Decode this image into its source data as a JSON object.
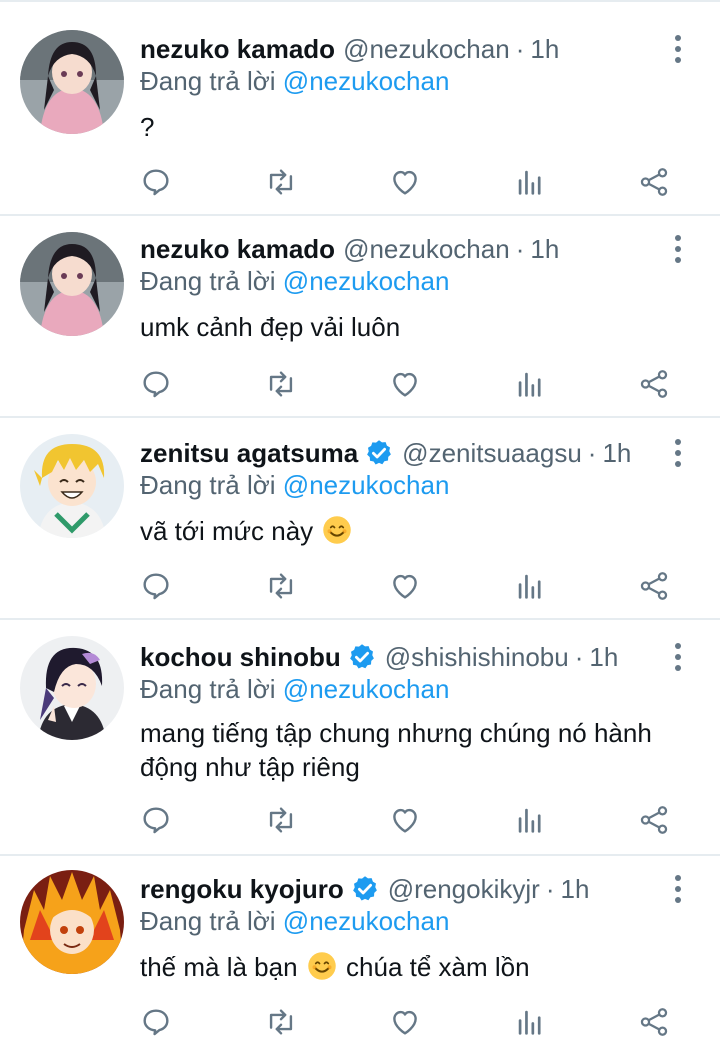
{
  "reply_prefix": "Đang trả lời",
  "tweets": [
    {
      "name": "nezuko kamado",
      "handle": "@nezukochan",
      "dot": "·",
      "time": "1h",
      "verified": false,
      "mention": "@nezukochan",
      "text": "?",
      "avatar_icon": "nezuko-avatar"
    },
    {
      "name": "nezuko kamado",
      "handle": "@nezukochan",
      "dot": "·",
      "time": "1h",
      "verified": false,
      "mention": "@nezukochan",
      "text": "umk cảnh đẹp vải luôn",
      "avatar_icon": "nezuko-avatar"
    },
    {
      "name": "zenitsu agatsuma",
      "handle": "@zenitsuaagsu",
      "dot": "·",
      "time": "1h",
      "verified": true,
      "mention": "@nezukochan",
      "text": "vã tới mức này",
      "text_after_emoji": "",
      "avatar_icon": "zenitsu-avatar"
    },
    {
      "name": "kochou shinobu",
      "handle": "@shishishinobu",
      "dot": "·",
      "time": "1h",
      "verified": true,
      "mention": "@nezukochan",
      "text": "mang tiếng tập chung nhưng chúng nó hành động như tập riêng",
      "avatar_icon": "shinobu-avatar"
    },
    {
      "name": "rengoku kyojuro",
      "handle": "@rengokikyjr",
      "dot": "·",
      "time": "1h",
      "verified": true,
      "mention": "@nezukochan",
      "text": "thế mà là bạn",
      "text_after_emoji": "chúa tể xàm lồn",
      "avatar_icon": "rengoku-avatar"
    }
  ],
  "colors": {
    "accent": "#1d9bf0",
    "secondary_text": "#536471",
    "icon": "#657786",
    "divider": "#e6ecf0"
  },
  "icons": [
    "reply-icon",
    "retweet-icon",
    "like-icon",
    "analytics-icon",
    "share-icon",
    "more-icon",
    "verified-badge-icon",
    "smiling-face-emoji"
  ]
}
